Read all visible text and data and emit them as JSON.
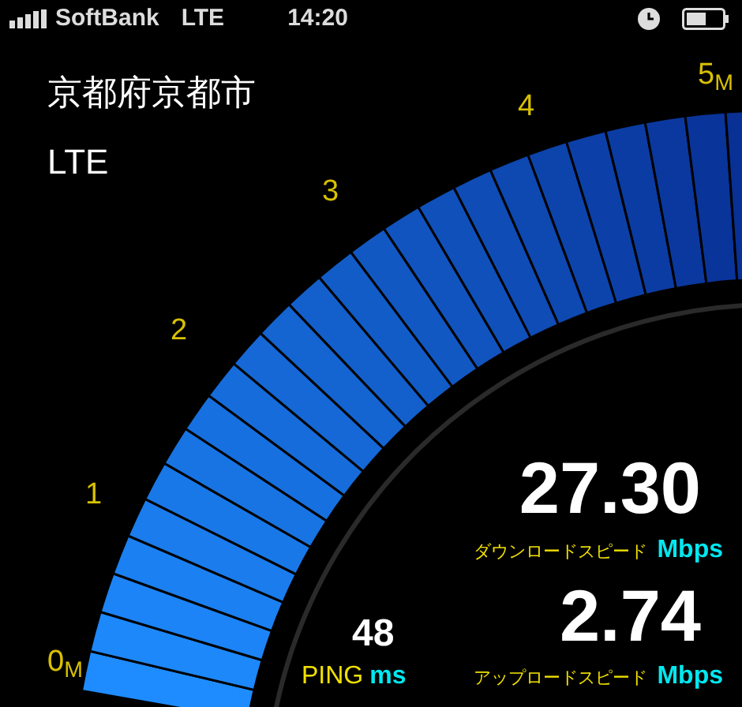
{
  "status_bar": {
    "carrier": "SoftBank",
    "network": "LTE",
    "time": "14:20"
  },
  "location": "京都府京都市",
  "connection": "LTE",
  "gauge": {
    "ticks": [
      "0$_{M}$",
      "1",
      "2",
      "3",
      "4",
      "5$_{M}$"
    ]
  },
  "download": {
    "value": "27.30",
    "label": "ダウンロードスピード",
    "unit": "Mbps"
  },
  "upload": {
    "value": "2.74",
    "label": "アップロードスピード",
    "unit": "Mbps"
  },
  "ping": {
    "value": "48",
    "label": "PING",
    "unit": "ms"
  }
}
